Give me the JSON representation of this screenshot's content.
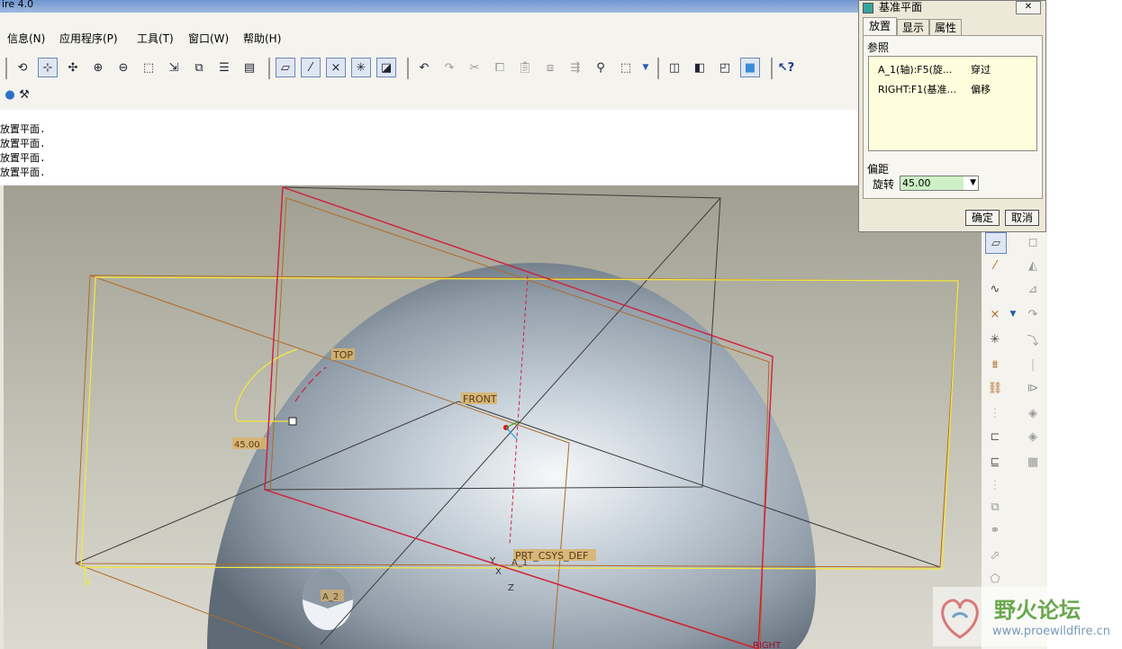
{
  "window": {
    "title": "ire 4.0"
  },
  "menu": [
    "信息(N)",
    "应用程序(P)",
    "工具(T)",
    "窗口(W)",
    "帮助(H)"
  ],
  "messages": [
    "放置平面.",
    "放置平面.",
    "放置平面.",
    "放置平面."
  ],
  "dialog": {
    "title": "基准平面",
    "tabs": [
      "放置",
      "显示",
      "属性"
    ],
    "references_label": "参照",
    "references": [
      {
        "name": "A_1(轴):F5(旋...",
        "type": "穿过"
      },
      {
        "name": "RIGHT:F1(基准...",
        "type": "偏移"
      }
    ],
    "offset_label": "偏距",
    "rotation_label": "旋转",
    "rotation_value": "45.00",
    "ok_label": "确定",
    "cancel_label": "取消"
  },
  "model": {
    "labels": {
      "top": "TOP",
      "front": "FRONT",
      "right": "RIGHT",
      "csys": "PRT_CSYS_DEF",
      "axis_a1": "A_1",
      "axis_a2": "A_2",
      "y": "Y",
      "x": "X",
      "z": "Z",
      "angle": "45.00"
    }
  },
  "watermark": {
    "text": "野火论坛",
    "url": "www.proewildfire.cn"
  },
  "colors": {
    "menu_bg": "#f4f3ee",
    "viewport_top": "#a09f92",
    "plane_yellow": "#f2e840",
    "plane_red": "#d21e3c",
    "datum_brown": "#b06a26",
    "label_bg": "#d9b36a",
    "ref_list_bg": "#fffedc",
    "rotation_field_bg": "#cdf0c6"
  }
}
